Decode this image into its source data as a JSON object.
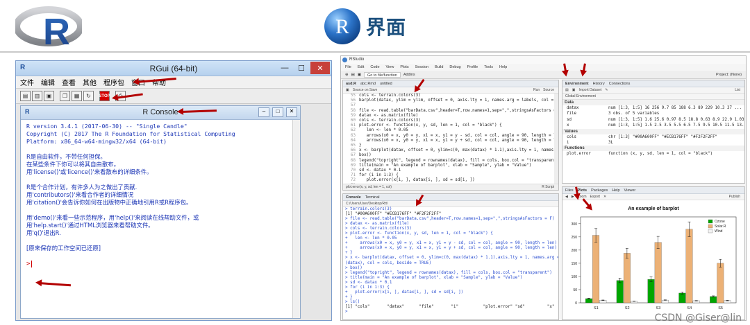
{
  "slide": {
    "logo_letter": "R",
    "title": "界面"
  },
  "rgui": {
    "title": "RGui (64-bit)",
    "menu": [
      "文件",
      "编辑",
      "查看",
      "其他",
      "程序包",
      "窗口",
      "帮助"
    ],
    "console_title": "R Console",
    "console_lines": [
      "R version 3.4.1 (2017-06-30) -- \"Single Candle\"",
      "Copyright (C) 2017 The R Foundation for Statistical Computing",
      "Platform: x86_64-w64-mingw32/x64 (64-bit)",
      "",
      "R是自由软件，不带任何担保。",
      "在某些条件下你可以将其自由散布。",
      "用'license()'或'licence()'来看散布的详细条件。",
      "",
      "R是个合作计划，有许多人为之做出了贡献.",
      "用'contributors()'来看合作者的详细情况",
      "用'citation()'会告诉你如何在出版物中正确地引用R或R程序包。",
      "",
      "用'demo()'来看一些示范程序，用'help()'来阅读在线帮助文件，或",
      "用'help.start()'通过HTML浏览器来看帮助文件。",
      "用'q()'退出R.",
      "",
      "[原来保存的工作空间已还原]",
      ""
    ],
    "prompt": ">"
  },
  "rstudio": {
    "title": "RStudio",
    "menu": [
      "File",
      "Edit",
      "Code",
      "View",
      "Plots",
      "Session",
      "Build",
      "Debug",
      "Profile",
      "Tools",
      "Help"
    ],
    "project": "Project: (None)",
    "go_to": "Go to file/function",
    "addins": "Addins",
    "editor_tabs": [
      "asd.R",
      "abc.Rmd",
      "untitled"
    ],
    "editor_tools": [
      "Source on Save",
      "Run",
      "Source"
    ],
    "editor_lines": [
      {
        "n": "55",
        "t": "cols <- terrain.colors(3)"
      },
      {
        "n": "56",
        "t": "barplot(datax, ylim = ylim, offset = 0, axis.lty = 1, names.arg = labels, col = cols, beside"
      },
      {
        "n": "57",
        "t": ""
      },
      {
        "n": "58",
        "t": "file <- read.table(\"barData.csv\",header=T,row.names=1,sep=\",\",stringsAsFactors = F)"
      },
      {
        "n": "59",
        "t": "datax <- as.matrix(file)"
      },
      {
        "n": "60",
        "t": "cols <- terrain.colors(3)"
      },
      {
        "n": "61",
        "t": "plot.error <- function(x, y, sd, len = 1, col = \"black\") {"
      },
      {
        "n": "62",
        "t": "   len <- len * 0.05"
      },
      {
        "n": "63",
        "t": "   arrows(x0 = x, y0 = y, x1 = x, y1 = y - sd, col = col, angle = 90, length = len)"
      },
      {
        "n": "64",
        "t": "   arrows(x0 = x, y0 = y, x1 = x, y1 = y + sd, col = col, angle = 90, length = len)"
      },
      {
        "n": "65",
        "t": "}"
      },
      {
        "n": "66",
        "t": "x <- barplot(datax, offset = 0, ylim=c(0, max(datax) * 1.1),axis.lty = 1, names.arg = colna"
      },
      {
        "n": "67",
        "t": "box()"
      },
      {
        "n": "68",
        "t": "legend(\"topright\", legend = rownames(datax), fill = cols, box.col = \"transparent\")"
      },
      {
        "n": "69",
        "t": "title(main = \"An example of barplot\", xlab = \"Sample\", ylab = \"Value\")"
      },
      {
        "n": "70",
        "t": "sd <- datax * 0.1"
      },
      {
        "n": "71",
        "t": "for (i in 1:3) {"
      },
      {
        "n": "72",
        "t": "   plot.error(x[i, ], datax[i, ], sd = sd[i, ])"
      },
      {
        "n": "73",
        "t": ""
      }
    ],
    "editor_status": "plot.error(x, y, sd, len = 1, col)",
    "editor_mode": "R Script",
    "env_tabs": [
      "Environment",
      "History",
      "Connections"
    ],
    "env_tools": [
      "Import Dataset",
      "List"
    ],
    "env_scope": "Global Environment",
    "env_sections": [
      {
        "label": "Data",
        "rows": [
          {
            "n": "datax",
            "v": "num [1:3, 1:5] 16 256 9.7 85 188 6.3 89 229 10.3 37 ..."
          },
          {
            "n": "file",
            "v": "3 obs. of 5 variables"
          },
          {
            "n": "sd",
            "v": "num [1:3, 1:5] 1.6 25.6 0.97 8.5 18.8 0.63 8.9 22.9 1.03 3..."
          },
          {
            "n": "x",
            "v": "num [1:3, 1:5] 1.5 2.5 3.5 5.5 6.5 7.5 9.5 10.5 11.5 13.5 ..."
          }
        ]
      },
      {
        "label": "Values",
        "rows": [
          {
            "n": "cols",
            "v": "chr [1:3] \"#00A600FF\" \"#ECB176FF\" \"#F2F2F2FF\""
          },
          {
            "n": "i",
            "v": "3L"
          }
        ]
      },
      {
        "label": "Functions",
        "rows": [
          {
            "n": "plot.error",
            "v": "function (x, y, sd, len = 1, col = \"black\")"
          }
        ]
      }
    ],
    "console_tabs": [
      "Console",
      "Terminal"
    ],
    "console_path": "C:/Users/User/Desktop/Rtt/",
    "console_lines": [
      {
        "c": "> terrain.colors(3)",
        "o": false
      },
      {
        "c": "[1] \"#00A600FF\" \"#ECB176FF\" \"#F2F2F2FF\"",
        "o": true
      },
      {
        "c": "> file <- read.table(\"barData.csv\",header=T,row.names=1,sep=\",\",stringsAsFactors = F)",
        "o": false
      },
      {
        "c": "> datax <- as.matrix(file)",
        "o": false
      },
      {
        "c": "> cols <- terrain.colors(3)",
        "o": false
      },
      {
        "c": "> plot.error <- function(x, y, sd, len = 1, col = \"black\") {",
        "o": false
      },
      {
        "c": "+   len <- len * 0.05",
        "o": false
      },
      {
        "c": "+     arrows(x0 = x, y0 = y, x1 = x, y1 = y - sd, col = col, angle = 90, length = len)",
        "o": false
      },
      {
        "c": "+     arrows(x0 = x, y0 = y, x1 = x, y1 = y + sd, col = col, angle = 90, length = len)",
        "o": false
      },
      {
        "c": "+ }",
        "o": false
      },
      {
        "c": "> x <- barplot(datax, offset = 0, ylim=c(0, max(datax) * 1.1),axis.lty = 1, names.arg = colnames",
        "o": false
      },
      {
        "c": "(datax), col = cols, beside = TRUE)",
        "o": false
      },
      {
        "c": "> box()",
        "o": false
      },
      {
        "c": "> legend(\"topright\", legend = rownames(datax), fill = cols, box.col = \"transparent\")",
        "o": false
      },
      {
        "c": "> title(main = \"An example of barplot\", xlab = \"Sample\", ylab = \"Value\")",
        "o": false
      },
      {
        "c": "> sd <- datax * 0.1",
        "o": false
      },
      {
        "c": "> for (i in 1:3) {",
        "o": false
      },
      {
        "c": "+   plot.error(x[i, ], datax[i, ], sd = sd[i, ])",
        "o": false
      },
      {
        "c": "+ }",
        "o": false
      },
      {
        "c": "> ls()",
        "o": false
      },
      {
        "c": "[1] \"cols\"       \"datax\"      \"file\"       \"i\"          \"plot.error\" \"sd\"         \"x\"",
        "o": true
      },
      {
        "c": ">",
        "o": false
      }
    ],
    "plot_tabs": [
      "Files",
      "Plots",
      "Packages",
      "Help",
      "Viewer"
    ],
    "plot_tools": [
      "Zoom",
      "Export",
      "Publish"
    ],
    "colors": {
      "green": "#00A600",
      "tan": "#ECB176",
      "white": "#F2F2F2"
    }
  },
  "chart_data": {
    "type": "bar",
    "title": "An example of barplot",
    "categories": [
      "S1",
      "S2",
      "S3",
      "S4",
      "S5"
    ],
    "series": [
      {
        "name": "Ozone",
        "values": [
          16,
          85,
          89,
          37,
          24
        ]
      },
      {
        "name": "Solar.R",
        "values": [
          256,
          188,
          229,
          279,
          150
        ]
      },
      {
        "name": "Wind",
        "values": [
          9.7,
          6.3,
          10.3,
          8.0,
          8.6
        ]
      }
    ],
    "ylim": [
      0,
      310
    ],
    "yticks": [
      0,
      50,
      100,
      150,
      200,
      250,
      300
    ],
    "error_fraction": 0.1,
    "legend": "top-right"
  },
  "watermark": "CSDN @Giser@lin"
}
